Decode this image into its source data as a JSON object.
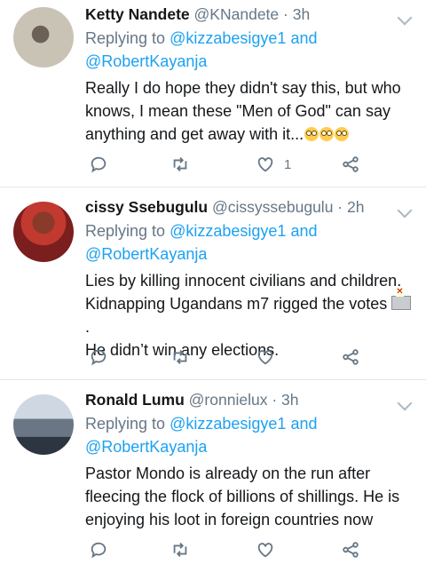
{
  "tweets": [
    {
      "name": "Ketty Nandete",
      "handle": "@KNandete",
      "time": "· 3h",
      "replying_prefix": "Replying to",
      "mention1": "@kizzabesigye1",
      "and": "and",
      "mention2": "@RobertKayanja",
      "text_lines": [
        "Really I do hope they didn't say this, but who",
        "knows, I mean these \"Men of God\" can say",
        "anything and get away with it..."
      ],
      "emojis": [
        "face-with-rolling-eyes",
        "face-with-rolling-eyes",
        "face-with-rolling-eyes"
      ],
      "like_count": "1"
    },
    {
      "name": "cissy Ssebugulu",
      "handle": "@cissyssebugulu",
      "time": "· 2h",
      "replying_prefix": "Replying to",
      "mention1": "@kizzabesigye1",
      "and": "and",
      "mention2": "@RobertKayanja",
      "text_lines": [
        "Lies by killing innocent civilians and children.",
        "Kidnapping Ugandans m7 rigged the votes",
        "He didn’t win any elections."
      ],
      "emojis": [
        "ballot-box-icon"
      ],
      "like_count": ""
    },
    {
      "name": "Ronald Lumu",
      "handle": "@ronnielux",
      "time": "· 3h",
      "replying_prefix": "Replying to",
      "mention1": "@kizzabesigye1",
      "and": "and",
      "mention2": "@RobertKayanja",
      "text_lines": [
        "Pastor Mondo is already on the run after",
        "fleecing the flock of billions of shillings. He is",
        "enjoying his loot in foreign countries now"
      ],
      "emojis": [],
      "like_count": ""
    }
  ],
  "icons": [
    "reply-icon",
    "retweet-icon",
    "like-icon",
    "share-icon",
    "chevron-down-icon"
  ],
  "colors": {
    "link": "#1da1f2",
    "meta": "#657786",
    "text": "#14171a",
    "divider": "#e1e8ed"
  }
}
